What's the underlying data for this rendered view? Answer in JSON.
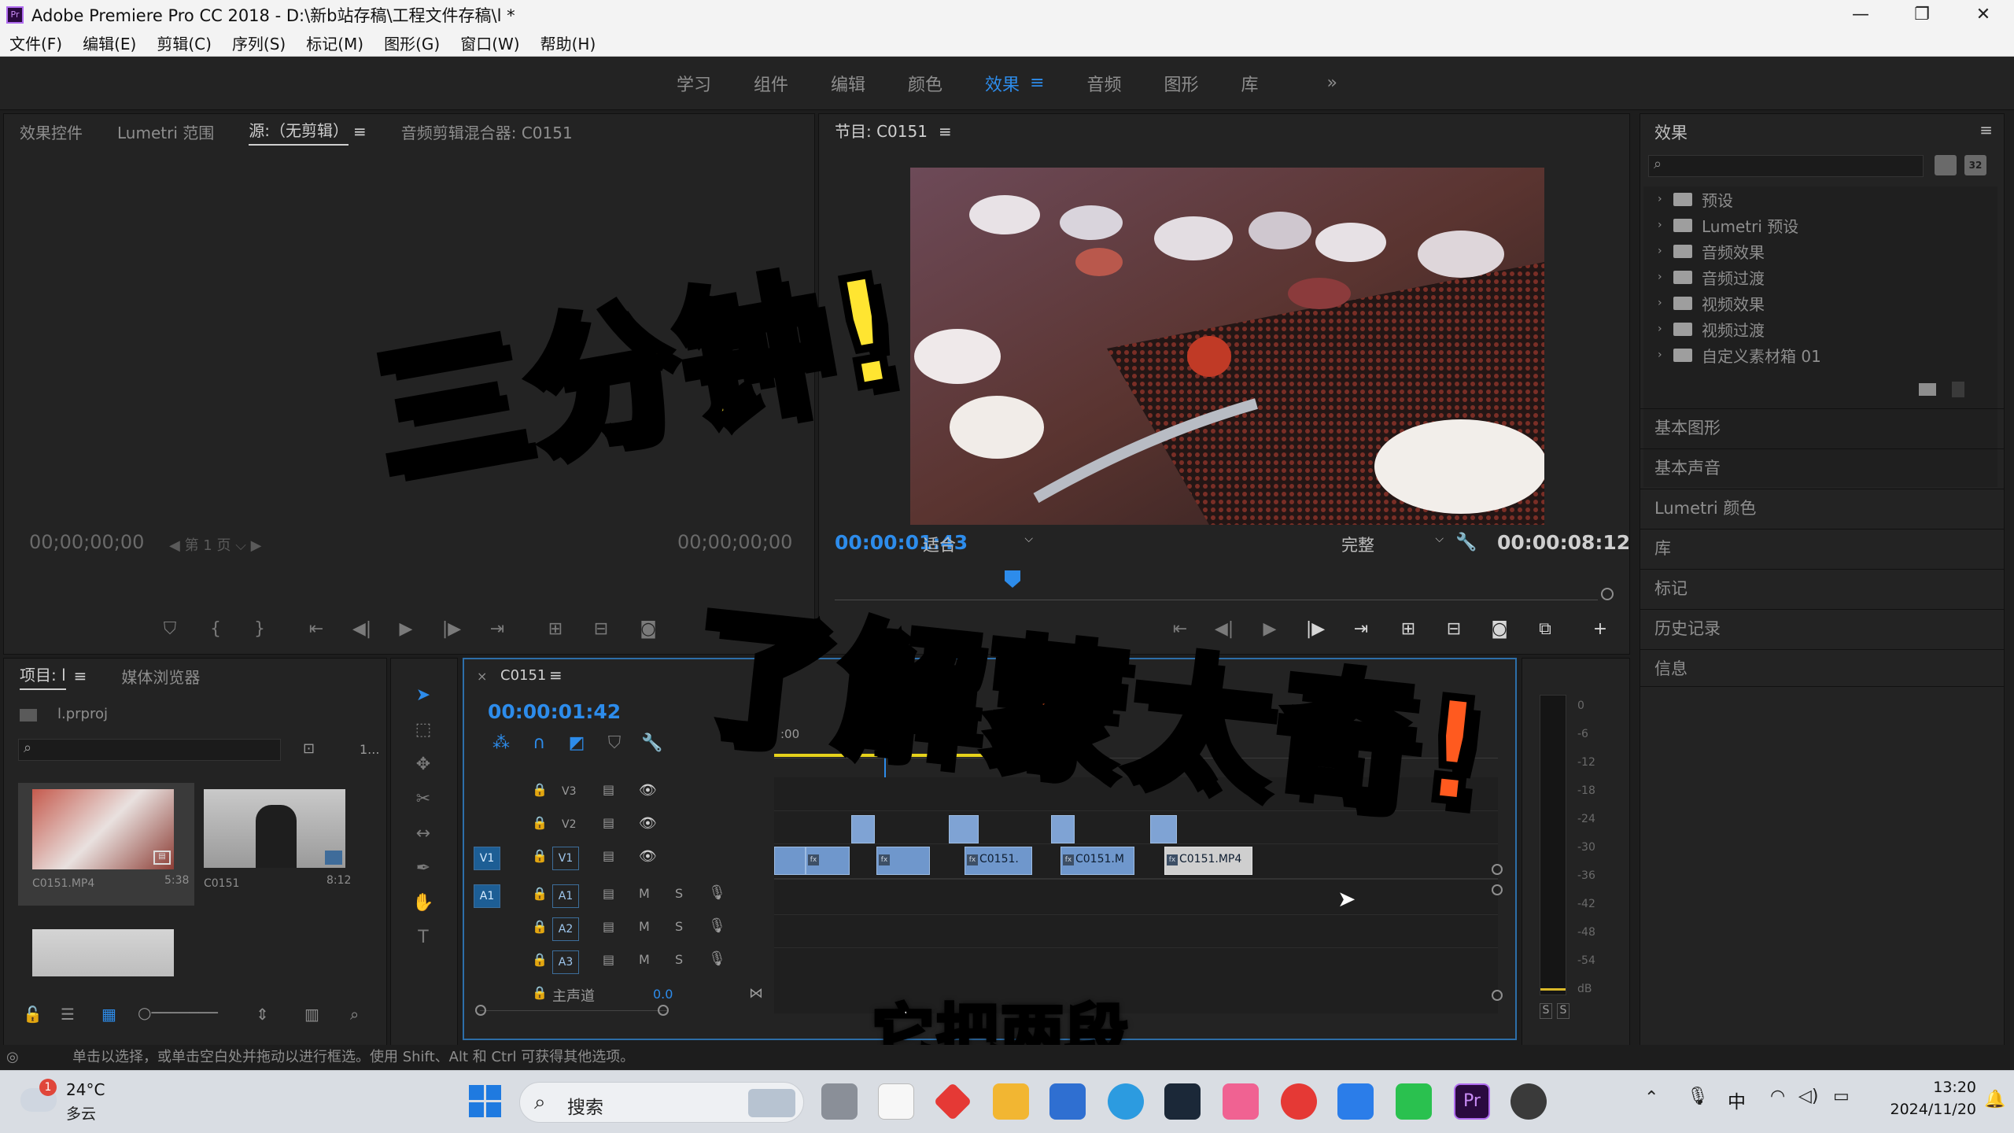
{
  "window": {
    "title": "Adobe Premiere Pro CC 2018 - D:\\新b站存稿\\工程文件存稿\\l *",
    "app_icon": "Pr"
  },
  "menu": [
    "文件(F)",
    "编辑(E)",
    "剪辑(C)",
    "序列(S)",
    "标记(M)",
    "图形(G)",
    "窗口(W)",
    "帮助(H)"
  ],
  "workspaces": {
    "items": [
      "学习",
      "组件",
      "编辑",
      "颜色",
      "效果",
      "音频",
      "图形",
      "库"
    ],
    "active": "效果",
    "more": "»"
  },
  "source_panel": {
    "tabs": [
      "效果控件",
      "Lumetri 范围",
      "源:（无剪辑）",
      "音频剪辑混合器: C0151"
    ],
    "active_tab": "源:（无剪辑）",
    "tc_left": "00;00;00;00",
    "tc_right": "00;00;00;00",
    "page_select": "第 1 页"
  },
  "program_panel": {
    "title": "节目: C0151",
    "timecode": "00:00:01:43",
    "fit": "适合",
    "quality": "完整",
    "duration": "00:00:08:12"
  },
  "effects_panel": {
    "title": "效果",
    "folders": [
      "预设",
      "Lumetri 预设",
      "音频效果",
      "音频过渡",
      "视频效果",
      "视频过渡",
      "自定义素材箱 01"
    ],
    "collapsed_panels": [
      "基本图形",
      "基本声音",
      "Lumetri 颜色",
      "库",
      "标记",
      "历史记录",
      "信息"
    ]
  },
  "project_panel": {
    "tabs": [
      "项目: l",
      "媒体浏览器"
    ],
    "file": "l.prproj",
    "count": "1...",
    "items": [
      {
        "name": "C0151.MP4",
        "duration": "5:38"
      },
      {
        "name": "C0151",
        "duration": "8:12"
      }
    ]
  },
  "timeline": {
    "sequence": "C0151",
    "timecode": "00:00:01:42",
    "ruler_start": ":00",
    "tracks_video": [
      "V3",
      "V2",
      "V1"
    ],
    "tracks_audio": [
      "A1",
      "A2",
      "A3"
    ],
    "master": "主声道",
    "master_value": "0.0",
    "clips_v1": [
      "C0151.",
      "C0151.M",
      "C0151.MP4"
    ]
  },
  "vu_meter": {
    "ticks": [
      "0",
      "-6",
      "-12",
      "-18",
      "-24",
      "-30",
      "-36",
      "-42",
      "-48",
      "-54",
      "dB"
    ],
    "solo": [
      "S",
      "S"
    ]
  },
  "overlays": {
    "headline_1": "三分钟!",
    "headline_2": "了解蒙太奇!",
    "subtitle": "它把两段"
  },
  "status_bar": "单击以选择，或单击空白处并拖动以进行框选。使用 Shift、Alt 和 Ctrl 可获得其他选项。",
  "taskbar": {
    "weather_temp": "24°C",
    "weather_desc": "多云",
    "weather_badge": "1",
    "search": "搜索",
    "ime": "中",
    "time": "13:20",
    "date": "2024/11/20"
  },
  "colors": {
    "accent_blue": "#2d8ceb",
    "headline_yellow": "#ffe531",
    "headline_orange": "#ff5a1f",
    "clip_blue": "#7fa3d4"
  }
}
